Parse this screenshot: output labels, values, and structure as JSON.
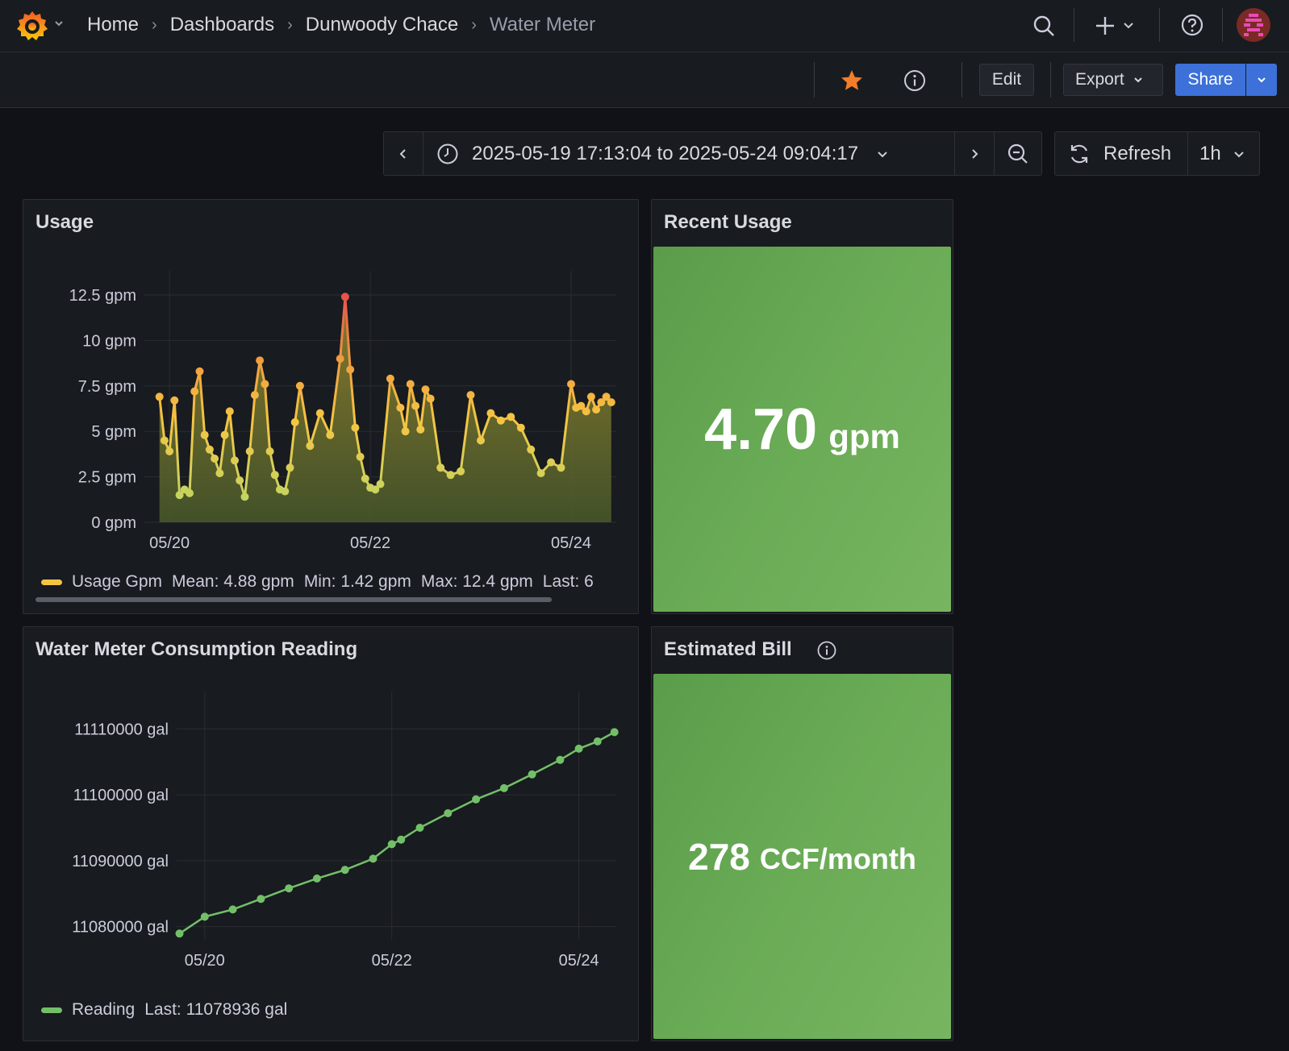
{
  "breadcrumb": {
    "items": [
      "Home",
      "Dashboards",
      "Dunwoody Chace"
    ],
    "current": "Water Meter",
    "separator": "›"
  },
  "toolbar": {
    "edit_label": "Edit",
    "export_label": "Export",
    "share_label": "Share"
  },
  "timepicker": {
    "range": "2025-05-19 17:13:04 to 2025-05-24 09:04:17",
    "refresh_label": "Refresh",
    "interval": "1h"
  },
  "colors": {
    "accent": "#3d71d9",
    "star": "#f07e2a",
    "stat_green": "#6aab56",
    "reading_green": "#73bf69",
    "usage_low": "#b7d86a",
    "usage_mid": "#f5c542",
    "usage_high": "#e8514a"
  },
  "panels": {
    "usage": {
      "title": "Usage",
      "legend": {
        "series": "Usage Gpm",
        "mean": "Mean: 4.88 gpm",
        "min": "Min: 1.42 gpm",
        "max": "Max: 12.4 gpm",
        "last": "Last: 6"
      }
    },
    "recent": {
      "title": "Recent Usage",
      "value": "4.70",
      "unit": "gpm"
    },
    "reading": {
      "title": "Water Meter Consumption Reading",
      "legend": {
        "series": "Reading",
        "last": "Last: 11078936 gal"
      }
    },
    "bill": {
      "title": "Estimated Bill",
      "value": "278",
      "unit": "CCF/month"
    }
  },
  "chart_data": [
    {
      "type": "area",
      "title": "Usage",
      "x_tick_labels": [
        "05/20",
        "05/22",
        "05/24"
      ],
      "y_tick_labels": [
        "0 gpm",
        "2.5 gpm",
        "5 gpm",
        "7.5 gpm",
        "10 gpm",
        "12.5 gpm"
      ],
      "ylim": [
        0,
        12.5
      ],
      "xlim": [
        -0.25,
        4.45
      ],
      "grid": true,
      "legend_position": "bottom",
      "series": [
        {
          "name": "Usage Gpm",
          "x": [
            -0.1,
            -0.05,
            0,
            0.05,
            0.1,
            0.15,
            0.2,
            0.25,
            0.3,
            0.35,
            0.4,
            0.45,
            0.5,
            0.55,
            0.6,
            0.65,
            0.7,
            0.75,
            0.8,
            0.85,
            0.9,
            0.95,
            1.0,
            1.05,
            1.1,
            1.15,
            1.2,
            1.25,
            1.3,
            1.4,
            1.5,
            1.6,
            1.7,
            1.75,
            1.8,
            1.85,
            1.9,
            1.95,
            2.0,
            2.05,
            2.1,
            2.2,
            2.3,
            2.35,
            2.4,
            2.45,
            2.5,
            2.55,
            2.6,
            2.7,
            2.8,
            2.9,
            3.0,
            3.1,
            3.2,
            3.3,
            3.4,
            3.5,
            3.6,
            3.7,
            3.8,
            3.9,
            4.0,
            4.05,
            4.1,
            4.15,
            4.2,
            4.25,
            4.3,
            4.35,
            4.4
          ],
          "values": [
            6.9,
            4.5,
            3.9,
            6.7,
            1.5,
            1.8,
            1.6,
            7.2,
            8.3,
            4.8,
            4.0,
            3.5,
            2.7,
            4.8,
            6.1,
            3.4,
            2.3,
            1.4,
            3.9,
            7.0,
            8.9,
            7.6,
            3.9,
            2.6,
            1.8,
            1.7,
            3.0,
            5.5,
            7.5,
            4.2,
            6.0,
            4.8,
            9.0,
            12.4,
            8.4,
            5.2,
            3.6,
            2.4,
            1.9,
            1.8,
            2.1,
            7.9,
            6.3,
            5.0,
            7.6,
            6.4,
            5.1,
            7.3,
            6.8,
            3.0,
            2.6,
            2.8,
            7.0,
            4.5,
            6.0,
            5.6,
            5.8,
            5.2,
            4.0,
            2.7,
            3.3,
            3.0,
            7.6,
            6.3,
            6.4,
            6.1,
            6.9,
            6.2,
            6.6,
            6.9,
            6.6
          ],
          "color": "#f5c542"
        }
      ]
    },
    {
      "type": "line",
      "title": "Water Meter Consumption Reading",
      "x_tick_labels": [
        "05/20",
        "05/22",
        "05/24"
      ],
      "y_tick_labels": [
        "11080000 gal",
        "11090000 gal",
        "11100000 gal",
        "11110000 gal"
      ],
      "ylim": [
        11078000,
        11112000
      ],
      "xlim": [
        -0.3,
        4.4
      ],
      "grid": true,
      "legend_position": "bottom",
      "series": [
        {
          "name": "Reading",
          "x": [
            -0.27,
            0,
            0.3,
            0.6,
            0.9,
            1.2,
            1.5,
            1.8,
            2.0,
            2.1,
            2.3,
            2.6,
            2.9,
            3.2,
            3.5,
            3.8,
            4.0,
            4.2,
            4.38
          ],
          "values": [
            11078936,
            11081500,
            11082600,
            11084200,
            11085800,
            11087300,
            11088600,
            11090300,
            11092500,
            11093200,
            11095000,
            11097200,
            11099300,
            11101000,
            11103100,
            11105300,
            11107000,
            11108100,
            11109500
          ],
          "color": "#73bf69"
        }
      ]
    }
  ]
}
